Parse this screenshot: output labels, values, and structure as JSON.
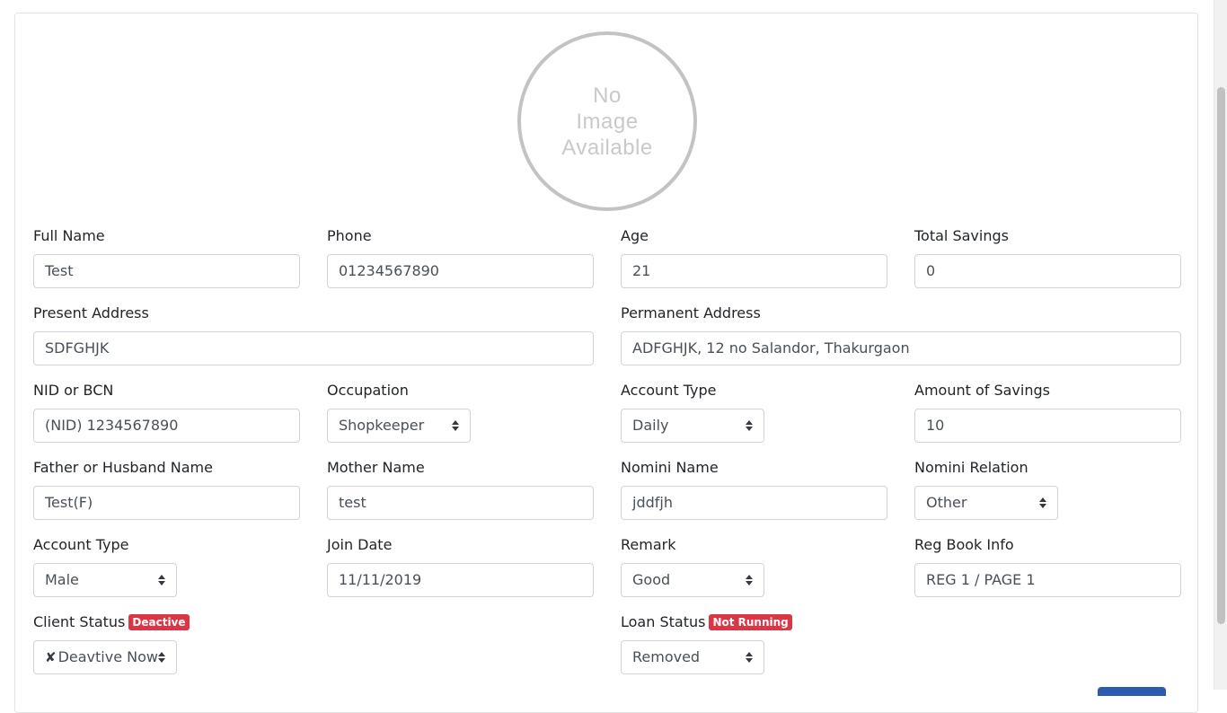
{
  "avatar": {
    "text": "No\nImage\nAvailable"
  },
  "form": {
    "full_name": {
      "label": "Full Name",
      "value": "Test"
    },
    "phone": {
      "label": "Phone",
      "value": "01234567890"
    },
    "age": {
      "label": "Age",
      "value": "21"
    },
    "total_savings": {
      "label": "Total Savings",
      "value": "0"
    },
    "present_address": {
      "label": "Present Address",
      "value": "SDFGHJK"
    },
    "permanent_address": {
      "label": "Permanent Address",
      "value": "ADFGHJK, 12 no Salandor, Thakurgaon"
    },
    "nid": {
      "label": "NID or BCN",
      "value": "(NID) 1234567890"
    },
    "occupation": {
      "label": "Occupation",
      "value": "Shopkeeper"
    },
    "account_type": {
      "label": "Account Type",
      "value": "Daily"
    },
    "amount_savings": {
      "label": "Amount of Savings",
      "value": "10"
    },
    "father_name": {
      "label": "Father or Husband Name",
      "value": "Test(F)"
    },
    "mother_name": {
      "label": "Mother Name",
      "value": "test"
    },
    "nomini_name": {
      "label": "Nomini Name",
      "value": "jddfjh"
    },
    "nomini_relation": {
      "label": "Nomini Relation",
      "value": "Other"
    },
    "gender": {
      "label": "Account Type",
      "value": "Male"
    },
    "join_date": {
      "label": "Join Date",
      "value": "11/11/2019"
    },
    "remark": {
      "label": "Remark",
      "value": "Good"
    },
    "reg_book": {
      "label": "Reg Book Info",
      "value": "REG 1 / PAGE 1"
    },
    "client_status": {
      "label": "Client Status",
      "badge": "Deactive",
      "value": "Deavtive Now",
      "icon": "x-icon"
    },
    "loan_status": {
      "label": "Loan Status",
      "badge": "Not Running",
      "value": "Removed"
    }
  },
  "colors": {
    "badge": "#dc3545",
    "border": "#ced4da",
    "primary": "#2c5bb0"
  }
}
